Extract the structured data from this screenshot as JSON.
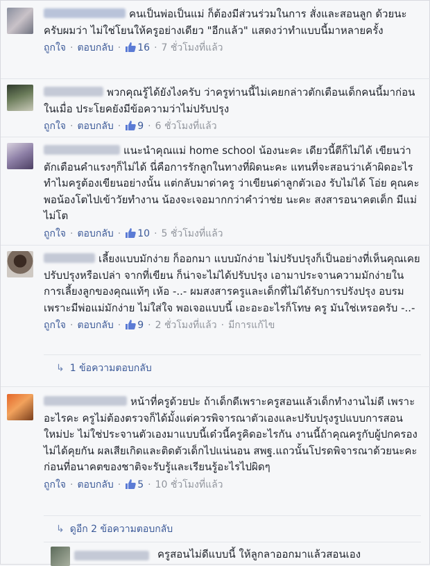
{
  "comments": [
    {
      "text": "คนเป็นพ่อเป็นแม่ ก็ต้องมีส่วนร่วมในการ สั่งและสอนลูก ด้วยนะครับผมว่า ไม่ใช่โยนให้ครูอย่างเดียว \"อีกแล้ว\" แสดงว่าทำแบบนี้มาหลายครั้ง",
      "like_label": "ถูกใจ",
      "reply_label": "ตอบกลับ",
      "likes": "16",
      "time": "7 ชั่วโมงที่แล้ว"
    },
    {
      "text": "พวกคุณรู้ได้ยังไงครับ ว่าครูท่านนี้ไม่เคยกล่าวตักเตือนเด็กคนนี้มาก่อนในเมื่อ ประโยคยังมีข้อความว่าไม่ปรับปรุง",
      "like_label": "ถูกใจ",
      "reply_label": "ตอบกลับ",
      "likes": "9",
      "time": "6 ชั่วโมงที่แล้ว"
    },
    {
      "text": "แนะนำคุณแม่ home school น้องนะคะ เดียวนี้ตีก็ไม่ได้ เขียนว่าตักเตือนคำแรงๆก็ไม่ได้ นี่คือการรักลูกในทางที่ผิดนะคะ แทนที่จะสอนว่าเค้าผิดอะไร ทำไมครูต้องเขียนอย่างนั้น แต่กลับมาด่าครู ว่าเขียนด่าลูกตัวเอง รับไม่ได้ โอ่ย คุณคะ พอน้องโตไปเข้าวัยทำงาน น้องจะเจอมากกว่าคำว่าช่ย นะคะ สงสารอนาคตเด็ก มีแม่ไม่โต",
      "like_label": "ถูกใจ",
      "reply_label": "ตอบกลับ",
      "likes": "10",
      "time": "5 ชั่วโมงที่แล้ว"
    },
    {
      "text": "เลี้ยงแบบมักง่าย ก็ออกมา แบบมักง่าย ไม่ปรับปรุงก็เป็นอย่างที่เห็นคุณเคยปรับปรุงหรือเปล่า จากที่เขียน ก็น่าจะไม่ได้ปรับปรุง เอามาประจานความมักง่ายในการเลี้ยงลูกของคุณแท้ๆ เห้อ -..- ผมสงสารครูและเด็กที่ไม่ได้รับการปรังปรุง อบรม เพราะมีพ่อแม่มักง่าย ไม่ใส่ใจ พอเจอแบบนี้ เอะอะอะไรก็โทษ ครู มันใช่เหรอครับ -..-",
      "like_label": "ถูกใจ",
      "reply_label": "ตอบกลับ",
      "likes": "9",
      "time": "2 ชั่วโมงที่แล้ว",
      "edited": "มีการแก้ไข",
      "replies_link": "1 ข้อความตอบกลับ"
    },
    {
      "text": "หน้าที่ครูด้วยปะ ถ้าเด็กดีเพราะครูสอนแล้วเด็กทำงานไม่ดี เพราะอะไรคะ ครูไม่ต้องตรวจก็ได้มั้งแต่ควรพิจารณาตัวเองและปรับปรุงรูปแบบการสอนใหม่ปะ ไม่ใช่ประจานตัวเองมาแบบนี้เด๋วนี้ครูคิดอะไรกัน งานนี้ถ้าคุณครูกับผู้ปกครองไม่ได้คุยกัน ผลเสียเกิดและติดตัวเด็กไปแน่นอน สพฐ.แถวนั้นโปรดพิจารณาด้วยนะคะ ก่อนที่อนาคตของชาติจะรับรู้และเรียนรู้อะไรไปผิดๆ",
      "like_label": "ถูกใจ",
      "reply_label": "ตอบกลับ",
      "likes": "5",
      "time": "10 ชั่วโมงที่แล้ว",
      "replies_link": "ดูอีก 2 ข้อความตอบกลับ"
    }
  ],
  "nested_reply": {
    "text": "ครูสอนไม่ดีแบบนี้ ให้ลูกลาออกมาแล้วสอนเอง"
  },
  "colors": {
    "link": "#3b5998",
    "meta": "#90949c",
    "background": "#f6f7f9",
    "like_icon": "#5b7bd5"
  }
}
